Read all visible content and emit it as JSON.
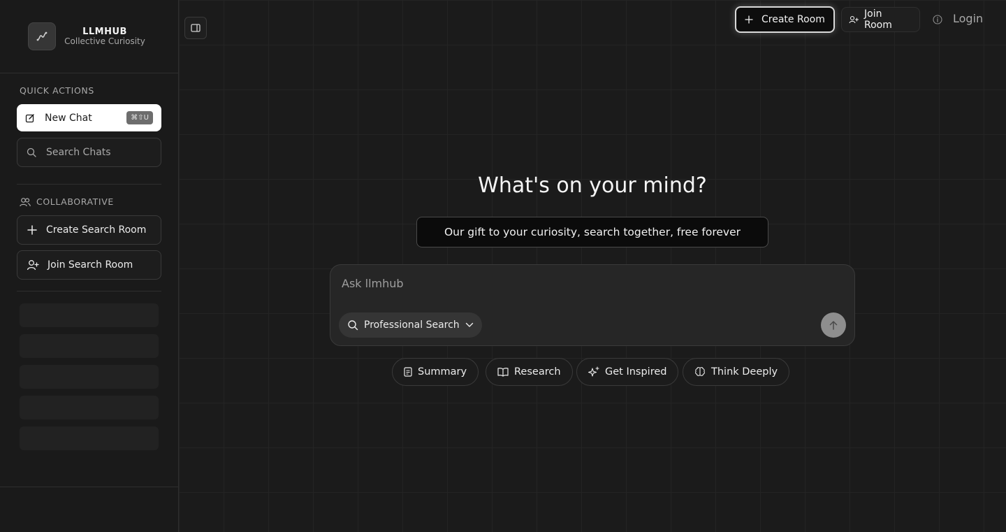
{
  "brand": {
    "name": "LLMHUB",
    "tagline": "Collective Curiosity"
  },
  "sidebar": {
    "quick_actions_label": "QUICK ACTIONS",
    "new_chat_label": "New Chat",
    "new_chat_shortcut": "⌘⇧U",
    "search_chats_label": "Search Chats",
    "collaborative_label": "COLLABORATIVE",
    "create_room_label": "Create Search Room",
    "join_room_label": "Join Search Room"
  },
  "header": {
    "create_room_label": "Create Room",
    "join_room_label": "Join Room",
    "login_label": "Login"
  },
  "main": {
    "headline": "What's on your mind?",
    "tagline": "Our gift to your curiosity, search together, free forever",
    "ask_placeholder": "Ask llmhub",
    "search_mode": "Professional Search",
    "chips": [
      {
        "label": "Summary",
        "icon": "document-icon"
      },
      {
        "label": "Research",
        "icon": "book-open-icon"
      },
      {
        "label": "Get Inspired",
        "icon": "sparkles-icon"
      },
      {
        "label": "Think Deeply",
        "icon": "brain-icon"
      }
    ]
  },
  "colors": {
    "background": "#1b1b1b",
    "sidebar": "#1a1a1a",
    "accent_button": "#ffffff",
    "send_button": "#8e8e8e"
  }
}
